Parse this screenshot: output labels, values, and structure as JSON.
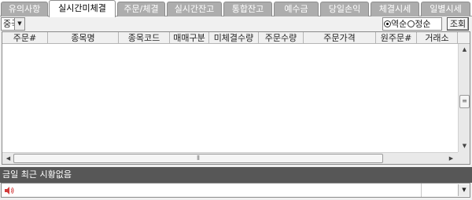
{
  "tabs": [
    {
      "label": "유의사항",
      "active": false
    },
    {
      "label": "실시간미체결",
      "active": true
    },
    {
      "label": "주문/체결",
      "active": false
    },
    {
      "label": "실시간잔고",
      "active": false
    },
    {
      "label": "통합잔고",
      "active": false
    },
    {
      "label": "예수금",
      "active": false
    },
    {
      "label": "당일손익",
      "active": false
    },
    {
      "label": "체결시세",
      "active": false
    },
    {
      "label": "일별시세",
      "active": false
    }
  ],
  "toolbar": {
    "market_combo_value": "중국",
    "combo_arrow_icon": "triangle-down-icon",
    "sort_options": [
      {
        "label": "역순",
        "checked": true
      },
      {
        "label": "정순",
        "checked": false
      }
    ],
    "query_button_label": "조회"
  },
  "grid": {
    "columns": [
      "주문#",
      "종목명",
      "종목코드",
      "매매구분",
      "미체결수량",
      "주문수량",
      "주문가격",
      "원주문#",
      "거래소"
    ],
    "rows": []
  },
  "status": {
    "message": "금일 최근 시황없음"
  },
  "message_bar": {
    "icon": "speaker-icon",
    "value": "",
    "accent_color": "#d23c3c"
  },
  "colors": {
    "tab_inactive_bg": "#adadad",
    "status_bar_bg": "#575757"
  }
}
